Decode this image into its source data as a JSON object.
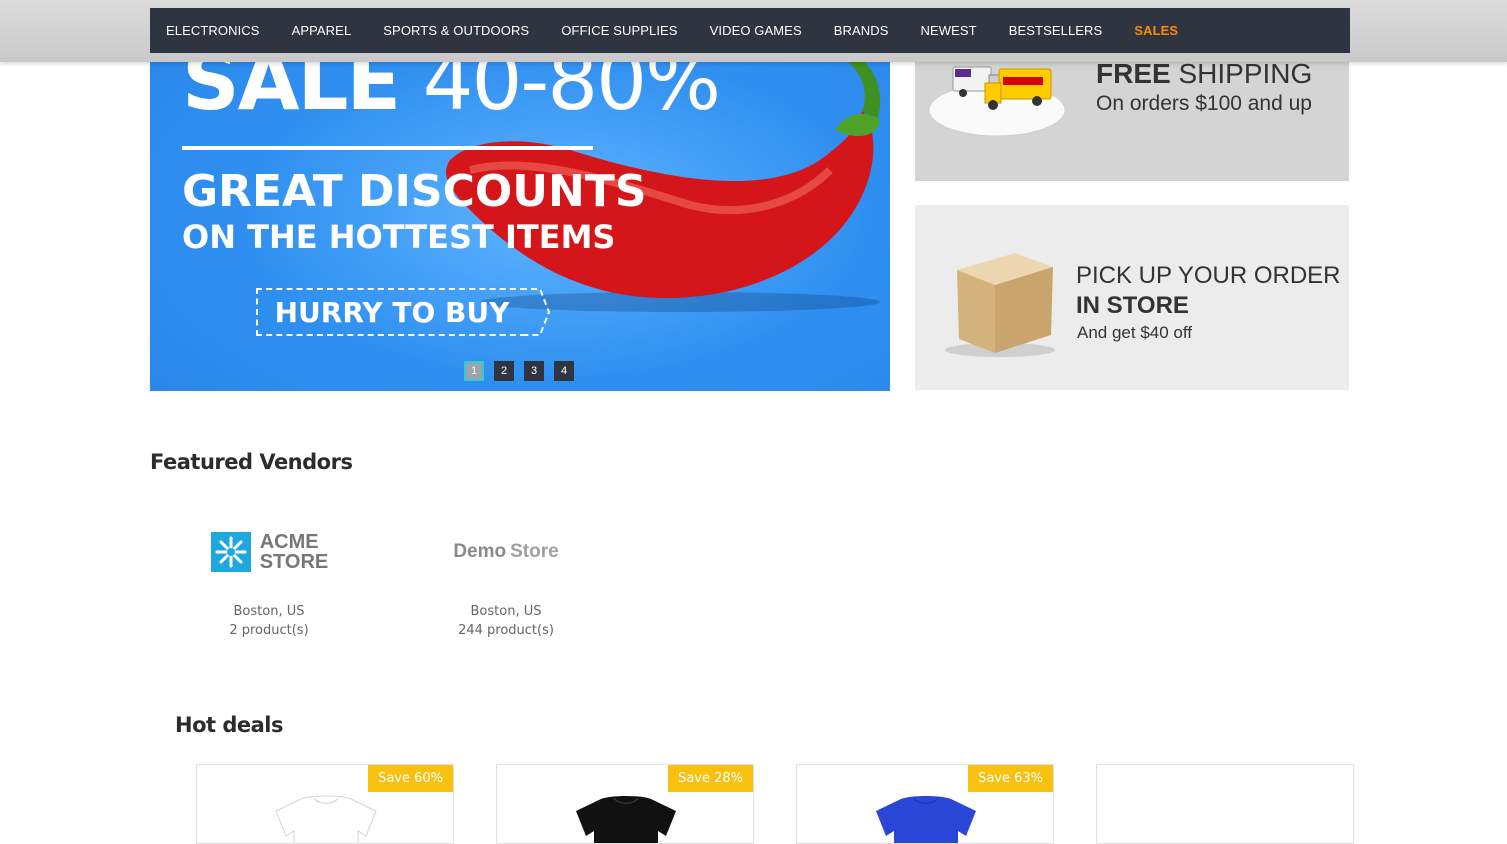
{
  "nav": {
    "items": [
      {
        "label": "ELECTRONICS"
      },
      {
        "label": "APPAREL"
      },
      {
        "label": "SPORTS & OUTDOORS"
      },
      {
        "label": "OFFICE SUPPLIES"
      },
      {
        "label": "VIDEO GAMES"
      },
      {
        "label": "BRANDS"
      },
      {
        "label": "NEWEST"
      },
      {
        "label": "BESTSELLERS"
      },
      {
        "label": "SALES"
      }
    ],
    "active_color": "#ff8a00"
  },
  "slider": {
    "sale_word": "SALE",
    "sale_range": "40-80%",
    "headline": "GREAT DISCOUNTS",
    "subheadline": "ON THE HOTTEST ITEMS",
    "cta": "HURRY TO BUY",
    "pages": [
      "1",
      "2",
      "3",
      "4"
    ],
    "active_page": "1",
    "background_color": "#2f8ff0"
  },
  "banner_shipping": {
    "title_bold": "FREE",
    "title_rest": "SHIPPING",
    "subtitle": "On orders $100 and up"
  },
  "banner_pickup": {
    "line1": "PICK UP YOUR ORDER",
    "line2": "IN STORE",
    "line3": "And get $40 off"
  },
  "featured_vendors": {
    "heading": "Featured Vendors",
    "vendors": [
      {
        "logo_top": "ACME",
        "logo_bottom": "STORE",
        "location": "Boston, US",
        "products": "2 product(s)"
      },
      {
        "logo_word1": "Demo",
        "logo_word2": "Store",
        "location": "Boston, US",
        "products": "244 product(s)"
      }
    ]
  },
  "hot_deals": {
    "heading": "Hot deals",
    "items": [
      {
        "badge": "Save 60%",
        "shirt_color": "#ffffff"
      },
      {
        "badge": "Save 28%",
        "shirt_color": "#111111"
      },
      {
        "badge": "Save 63%",
        "shirt_color": "#2a46d6"
      },
      {
        "badge": "",
        "shirt_color": ""
      }
    ],
    "badge_color": "#f8c10f"
  }
}
